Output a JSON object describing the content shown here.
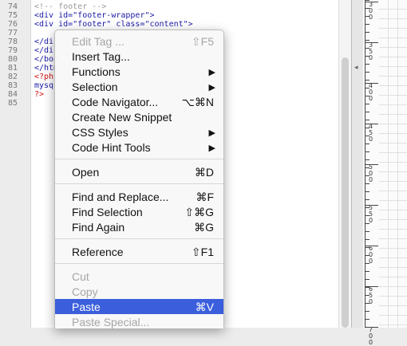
{
  "editor": {
    "line_numbers": [
      "74",
      "75",
      "76",
      "77",
      "78",
      "79",
      "80",
      "81",
      "82",
      "83",
      "84",
      "85"
    ],
    "lines": [
      {
        "text": "<!-- footer -->",
        "kind": "comment"
      },
      {
        "text": "<div id=\"footer-wrapper\">",
        "kind": "tag"
      },
      {
        "text": "<div id=\"footer\" class=\"content\">",
        "kind": "tag"
      },
      {
        "text": "",
        "kind": "plain"
      },
      {
        "text": "</di",
        "kind": "tag"
      },
      {
        "text": "</di",
        "kind": "tag"
      },
      {
        "text": "</bod",
        "kind": "tag"
      },
      {
        "text": "</htm",
        "kind": "tag"
      },
      {
        "text": "<?php",
        "kind": "php"
      },
      {
        "text": "mysq",
        "kind": "tag"
      },
      {
        "text": "?>",
        "kind": "php"
      },
      {
        "text": "",
        "kind": "plain"
      }
    ]
  },
  "ruler": {
    "labels": [
      "3",
      "0",
      "0",
      "3",
      "5",
      "0",
      "4",
      "0",
      "0",
      "4",
      "5",
      "0",
      "5",
      "0",
      "0",
      "5",
      "5",
      "0",
      "6",
      "0",
      "0",
      "6",
      "5",
      "0",
      "7",
      "0",
      "0"
    ]
  },
  "context_menu": {
    "items": [
      {
        "label": "Edit Tag ...",
        "shortcut": "⇧F5",
        "submenu": false,
        "disabled": true
      },
      {
        "label": "Insert Tag...",
        "shortcut": "",
        "submenu": false,
        "disabled": false
      },
      {
        "label": "Functions",
        "shortcut": "",
        "submenu": true,
        "disabled": false
      },
      {
        "label": "Selection",
        "shortcut": "",
        "submenu": true,
        "disabled": false
      },
      {
        "label": "Code Navigator...",
        "shortcut": "⌥⌘N",
        "submenu": false,
        "disabled": false
      },
      {
        "label": "Create New Snippet",
        "shortcut": "",
        "submenu": false,
        "disabled": false
      },
      {
        "label": "CSS Styles",
        "shortcut": "",
        "submenu": true,
        "disabled": false
      },
      {
        "label": "Code Hint Tools",
        "shortcut": "",
        "submenu": true,
        "disabled": false
      },
      {
        "label": "Open",
        "shortcut": "⌘D",
        "submenu": false,
        "disabled": false
      },
      {
        "label": "Find and Replace...",
        "shortcut": "⌘F",
        "submenu": false,
        "disabled": false
      },
      {
        "label": "Find Selection",
        "shortcut": "⇧⌘G",
        "submenu": false,
        "disabled": false
      },
      {
        "label": "Find Again",
        "shortcut": "⌘G",
        "submenu": false,
        "disabled": false
      },
      {
        "label": "Reference",
        "shortcut": "⇧F1",
        "submenu": false,
        "disabled": false
      },
      {
        "label": "Cut",
        "shortcut": "",
        "submenu": false,
        "disabled": true
      },
      {
        "label": "Copy",
        "shortcut": "",
        "submenu": false,
        "disabled": true
      },
      {
        "label": "Paste",
        "shortcut": "⌘V",
        "submenu": false,
        "disabled": false,
        "highlighted": true
      },
      {
        "label": "Paste Special...",
        "shortcut": "",
        "submenu": false,
        "disabled": true
      }
    ],
    "submenu_arrow": "▶",
    "highlight_color": "#3b5edc"
  }
}
